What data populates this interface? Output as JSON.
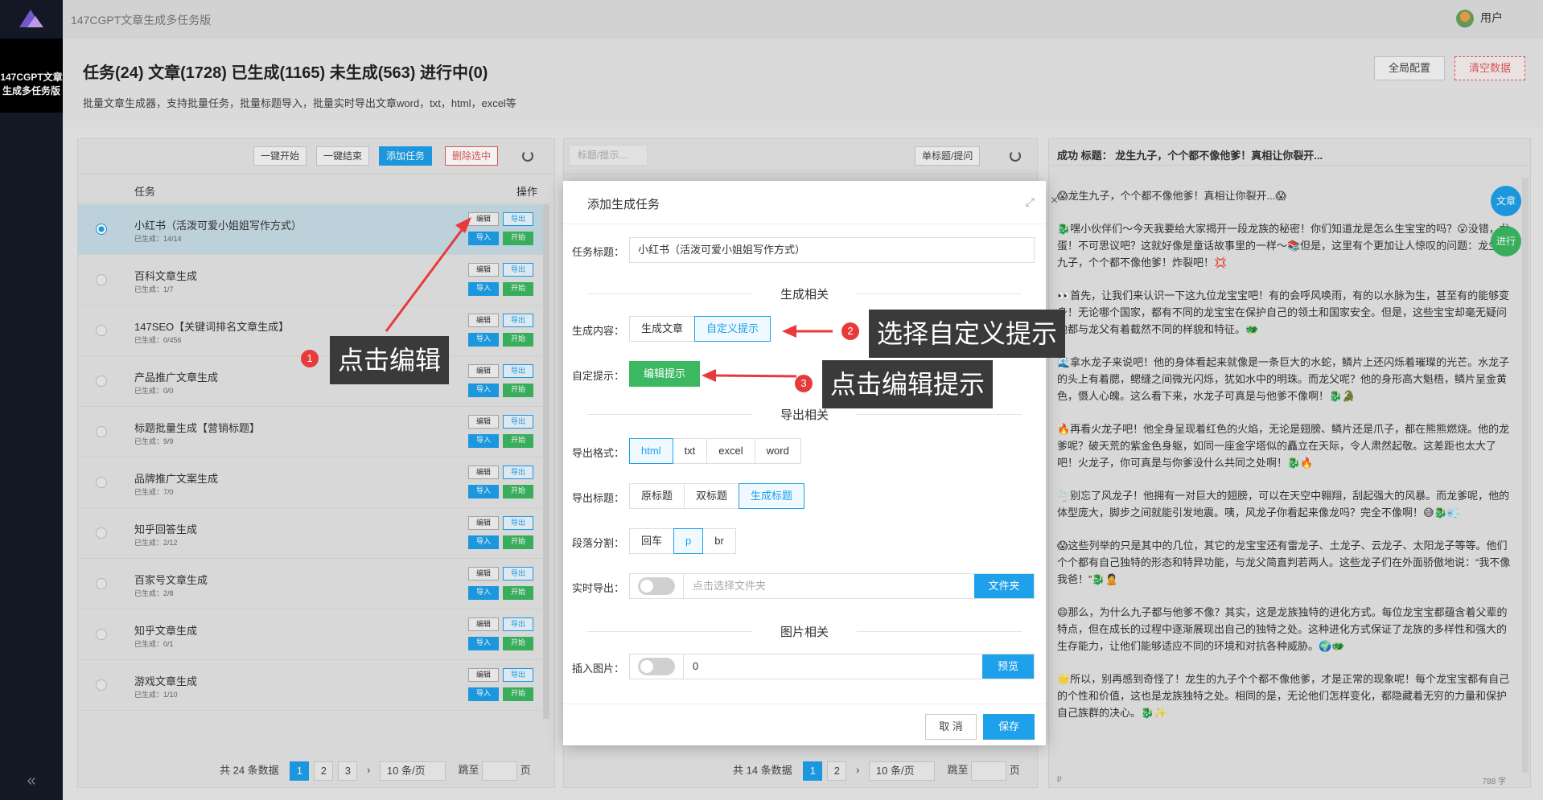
{
  "app": {
    "title": "147CGPT文章生成多任务版",
    "sidebar_active_label": "147CGPT文章生成多任务版",
    "collapse_icon": "«"
  },
  "topbar": {
    "user": "用户"
  },
  "header": {
    "stats": "任务(24) 文章(1728) 已生成(1165) 未生成(563) 进行中(0)",
    "desc": "批量文章生成器，支持批量任务，批量标题导入，批量实时导出文章word，txt，html，excel等",
    "global_config": "全局配置",
    "clear_data": "清空数据"
  },
  "task_panel": {
    "toolbar": {
      "start_all": "一键开始",
      "stop_all": "一键结束",
      "add_task": "添加任务",
      "delete_selected": "删除选中"
    },
    "columns": {
      "task": "任务",
      "actions": "操作"
    },
    "row_buttons": {
      "edit": "编辑",
      "export": "导出",
      "import": "导入",
      "start": "开始"
    },
    "rows": [
      {
        "name": "小红书（活泼可爱小姐姐写作方式）",
        "progress": "已生成：14/14"
      },
      {
        "name": "百科文章生成",
        "progress": "已生成：1/7"
      },
      {
        "name": "147SEO【关键词排名文章生成】",
        "progress": "已生成：0/456"
      },
      {
        "name": "产品推广文章生成",
        "progress": "已生成：0/0"
      },
      {
        "name": "标题批量生成【营销标题】",
        "progress": "已生成：9/9"
      },
      {
        "name": "品牌推广文案生成",
        "progress": "已生成：7/0"
      },
      {
        "name": "知乎回答生成",
        "progress": "已生成：2/12"
      },
      {
        "name": "百家号文章生成",
        "progress": "已生成：2/8"
      },
      {
        "name": "知乎文章生成",
        "progress": "已生成：0/1"
      },
      {
        "name": "游戏文章生成",
        "progress": "已生成：1/10"
      }
    ],
    "pager": {
      "total": "共 24 条数据",
      "pages": [
        "1",
        "2",
        "3"
      ],
      "page_size": "10 条/页",
      "jump": "跳至",
      "page_suffix": "页"
    }
  },
  "title_panel": {
    "search_placeholder": "标题/提示...",
    "single_title": "单标题/提问",
    "pager": {
      "total": "共 14 条数据",
      "pages": [
        "1",
        "2"
      ],
      "page_size": "10 条/页",
      "jump": "跳至",
      "page_suffix": "页"
    }
  },
  "article_panel": {
    "header": "成功 标题： 龙生九子，个个都不像他爹！真相让你裂开...",
    "paragraphs": [
      "😱龙生九子，个个都不像他爹！真相让你裂开...😱",
      "🐉嘿小伙伴们～今天我要给大家揭开一段龙族的秘密！你们知道龙是怎么生宝宝的吗？😮没错，龙蛋！不可思议吧？这就好像是童话故事里的一样～📚但是，这里有个更加让人惊叹的问题：龙生的九子，个个都不像他爹！炸裂吧！💢",
      "👀首先，让我们来认识一下这九位龙宝宝吧！有的会呼风唤雨，有的以水脉为生，甚至有的能够变身！无论哪个国家，都有不同的龙宝宝在保护自己的领土和国家安全。但是，这些宝宝却毫无疑问地都与龙父有着截然不同的样貌和特征。🐲",
      "🌊拿水龙子来说吧！他的身体看起来就像是一条巨大的水蛇，鳞片上还闪烁着璀璨的光芒。水龙子的头上有着腮，鳃缝之间微光闪烁，犹如水中的明珠。而龙父呢？他的身形高大魁梧，鳞片呈金黄色，慑人心魄。这么看下来，水龙子可真是与他爹不像啊！🐉🐊",
      "🔥再看火龙子吧！他全身呈现着红色的火焰，无论是翅膀、鳞片还是爪子，都在熊熊燃烧。他的龙爹呢？破天荒的紫金色身躯，如同一座金字塔似的矗立在天际，令人肃然起敬。这差距也太大了吧！火龙子，你可真是与你爹没什么共同之处啊！🐉🔥",
      "🌪️别忘了风龙子！他拥有一对巨大的翅膀，可以在天空中翱翔，刮起强大的风暴。而龙爹呢，他的体型庞大，脚步之间就能引发地震。咦，风龙子你看起来像龙吗？完全不像啊！😅🐉💨",
      "😱这些列举的只是其中的几位，其它的龙宝宝还有雷龙子、土龙子、云龙子、太阳龙子等等。他们个个都有自己独特的形态和特异功能，与龙父简直判若两人。这些龙子们在外面骄傲地说：“我不像我爸！”🐉🙎",
      "😄那么，为什么九子都与他爹不像？其实，这是龙族独特的进化方式。每位龙宝宝都蕴含着父辈的特点，但在成长的过程中逐渐展现出自己的独特之处。这种进化方式保证了龙族的多样性和强大的生存能力，让他们能够适应不同的环境和对抗各种威胁。🌍🐲",
      "🌟所以，别再感到奇怪了！龙生的九子个个都不像他爹，才是正常的现象呢！每个龙宝宝都有自己的个性和价值，这也是龙族独特之处。相同的是，无论他们怎样变化，都隐藏着无穷的力量和保护自己族群的决心。🐉✨"
    ],
    "footer_left": "p",
    "footer_count": "788 字",
    "float_article": "文章",
    "float_running": "进行"
  },
  "modal": {
    "title": "添加生成任务",
    "task_title_label": "任务标题：",
    "task_title_value": "小红书（活泼可爱小姐姐写作方式）",
    "section_gen": "生成相关",
    "gen_content_label": "生成内容：",
    "gen_options": [
      "生成文章",
      "自定义提示"
    ],
    "custom_prompt_label": "自定提示：",
    "edit_prompt_button": "编辑提示",
    "section_export": "导出相关",
    "export_format_label": "导出格式：",
    "export_formats": [
      "html",
      "txt",
      "excel",
      "word"
    ],
    "export_title_label": "导出标题：",
    "export_titles": [
      "原标题",
      "双标题",
      "生成标题"
    ],
    "para_split_label": "段落分割：",
    "para_splits": [
      "回车",
      "p",
      "br"
    ],
    "realtime_export_label": "实时导出：",
    "folder_placeholder": "点击选择文件夹",
    "folder_button": "文件夹",
    "section_image": "图片相关",
    "insert_image_label": "插入图片：",
    "insert_image_value": "0",
    "preview_button": "预览",
    "cancel": "取 消",
    "save": "保存"
  },
  "annotations": {
    "step1": {
      "num": "1",
      "text": "点击编辑"
    },
    "step2": {
      "num": "2",
      "text": "选择自定义提示"
    },
    "step3": {
      "num": "3",
      "text": "点击编辑提示"
    }
  },
  "colors": {
    "primary": "#1ea0ea",
    "success": "#3bb861",
    "danger": "#e15b5b",
    "annotation_red": "#e83a3a"
  }
}
